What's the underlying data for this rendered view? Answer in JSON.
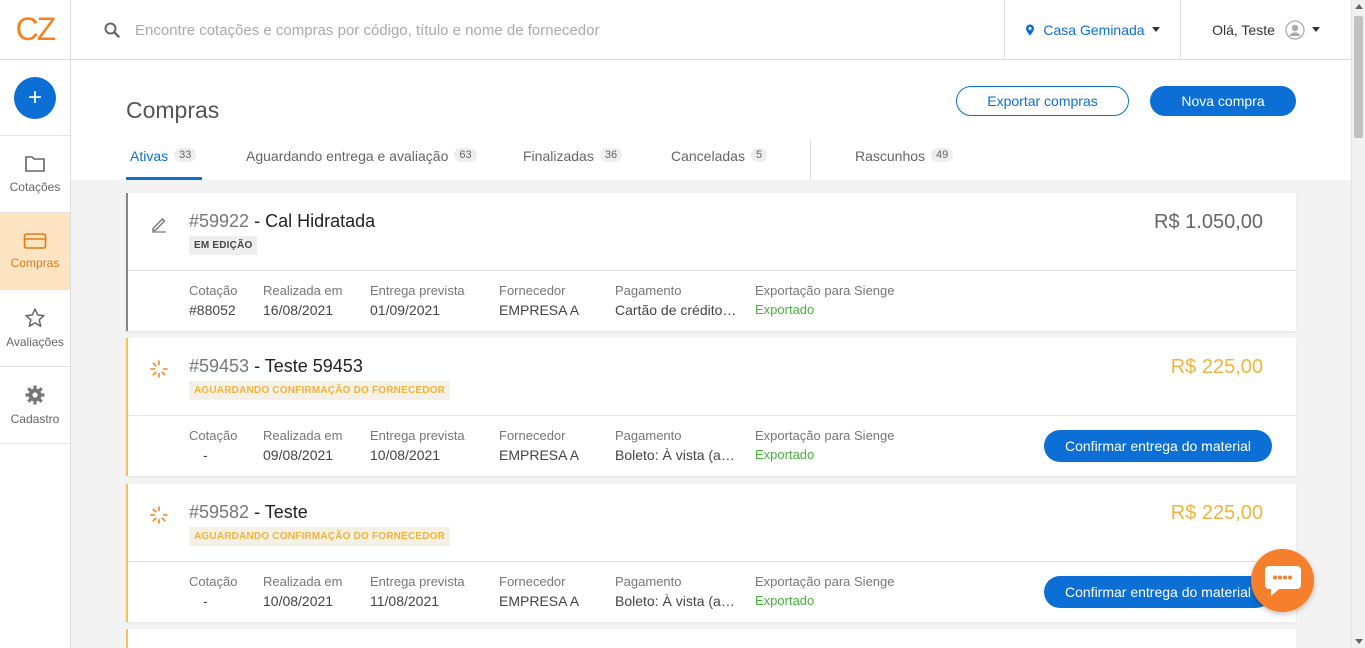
{
  "brand": {
    "logo_text": "CZ",
    "accent": "#0b6fd6",
    "orange": "#f57f2a"
  },
  "sidebar": {
    "add_label": "+",
    "items": [
      {
        "label": "Cotações",
        "icon": "folder-icon",
        "active": false
      },
      {
        "label": "Compras",
        "icon": "card-icon",
        "active": true
      },
      {
        "label": "Avaliações",
        "icon": "star-icon",
        "active": false
      },
      {
        "label": "Cadastro",
        "icon": "gear-icon",
        "active": false
      }
    ]
  },
  "topbar": {
    "search_placeholder": "Encontre cotações e compras por código, título e nome de fornecedor",
    "company": "Casa Geminada",
    "greeting": "Olá, Teste"
  },
  "page": {
    "title": "Compras",
    "export_label": "Exportar compras",
    "new_label": "Nova compra"
  },
  "tabs": [
    {
      "label": "Ativas",
      "count": "33",
      "active": true
    },
    {
      "label": "Aguardando entrega e avaliação",
      "count": "63",
      "active": false
    },
    {
      "label": "Finalizadas",
      "count": "36",
      "active": false
    },
    {
      "label": "Canceladas",
      "count": "5",
      "active": false
    },
    {
      "label": "Rascunhos",
      "count": "49",
      "active": false
    }
  ],
  "field_labels": {
    "quote": "Cotação",
    "made_on": "Realizada em",
    "expected": "Entrega prevista",
    "supplier": "Fornecedor",
    "payment": "Pagamento",
    "export": "Exportação para Sienge"
  },
  "purchases": [
    {
      "id": "#59922",
      "title": " - Cal Hidratada",
      "status": "EM EDIÇÃO",
      "price": "R$ 1.050,00",
      "quote": "#88052",
      "made_on": "16/08/2021",
      "expected": "01/09/2021",
      "supplier": "EMPRESA A",
      "payment": "Cartão de crédito…",
      "export_status": "Exportado",
      "action": ""
    },
    {
      "id": "#59453",
      "title": " - Teste 59453",
      "status": "AGUARDANDO CONFIRMAÇÃO DO FORNECEDOR",
      "price": "R$ 225,00",
      "quote": "-",
      "made_on": "09/08/2021",
      "expected": "10/08/2021",
      "supplier": "EMPRESA A",
      "payment": "Boleto: À vista (a…",
      "export_status": "Exportado",
      "action": "Confirmar entrega do material"
    },
    {
      "id": "#59582",
      "title": " - Teste",
      "status": "AGUARDANDO CONFIRMAÇÃO DO FORNECEDOR",
      "price": "R$ 225,00",
      "quote": "-",
      "made_on": "10/08/2021",
      "expected": "11/08/2021",
      "supplier": "EMPRESA A",
      "payment": "Boleto: À vista (a…",
      "export_status": "Exportado",
      "action": "Confirmar entrega do material"
    }
  ]
}
